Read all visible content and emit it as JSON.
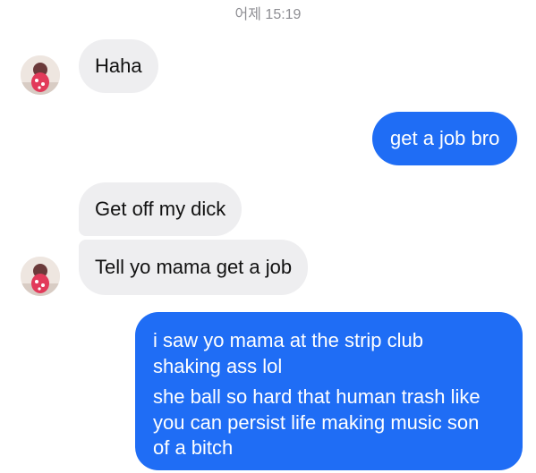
{
  "conversation": {
    "timestamp": "어제 15:19",
    "messages": [
      {
        "sender": "them",
        "text": "Haha"
      },
      {
        "sender": "me",
        "text": "get a job bro"
      },
      {
        "sender": "them",
        "text": "Get off my dick"
      },
      {
        "sender": "them",
        "text": "Tell yo mama get a job"
      },
      {
        "sender": "me",
        "lines": [
          "i saw yo mama at the strip club",
          "shaking ass lol",
          "she ball so hard that human trash like",
          "you can persist life making music son",
          "of a bitch"
        ]
      }
    ]
  },
  "colors": {
    "incoming_bubble": "#eeeef0",
    "outgoing_bubble": "#1f6df5",
    "timestamp_text": "#8e8e93"
  }
}
